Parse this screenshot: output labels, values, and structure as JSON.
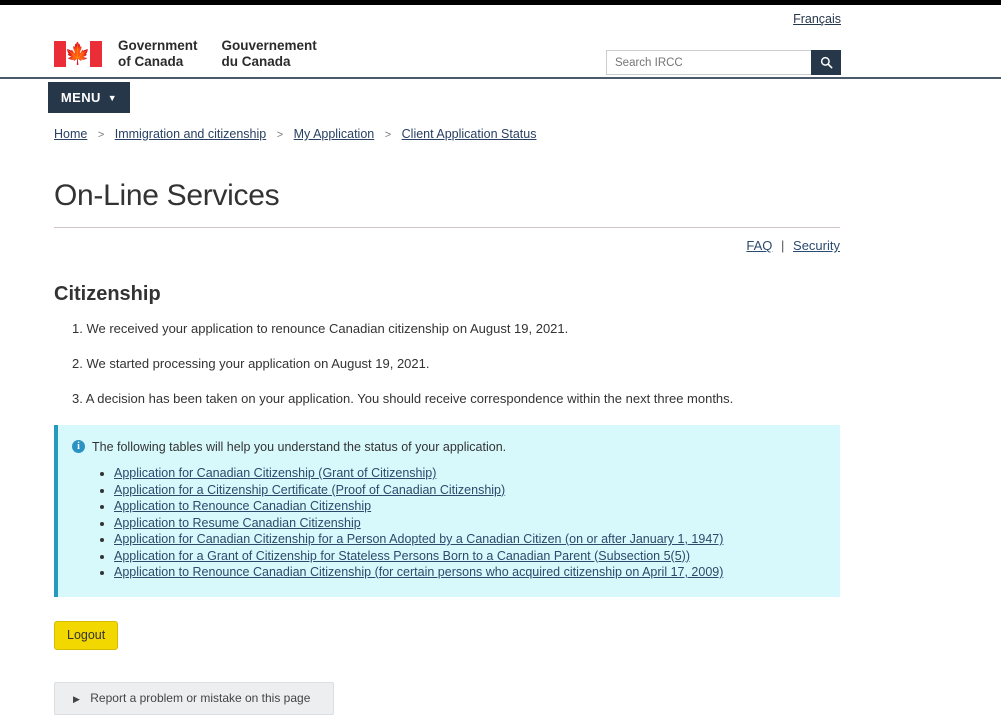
{
  "topbar": {
    "language_link": "Français"
  },
  "brand": {
    "flag_icon": "canada-flag-icon",
    "line_en_1": "Government",
    "line_en_2": "of Canada",
    "line_fr_1": "Gouvernement",
    "line_fr_2": "du Canada"
  },
  "search": {
    "placeholder": "Search IRCC",
    "value": "",
    "button_icon": "search-icon"
  },
  "menu": {
    "label": "MENU",
    "caret_icon": "chevron-down-icon"
  },
  "breadcrumb": {
    "separator": ">",
    "items": [
      {
        "label": "Home"
      },
      {
        "label": "Immigration and citizenship"
      },
      {
        "label": "My Application"
      },
      {
        "label": "Client Application Status"
      }
    ]
  },
  "main": {
    "page_title": "On-Line Services",
    "util_links": {
      "faq": "FAQ",
      "divider": "|",
      "security": "Security"
    },
    "section_title": "Citizenship",
    "status_items": [
      "1. We received your application to renounce Canadian citizenship on August 19, 2021.",
      "2. We started processing your application on August 19, 2021.",
      "3. A decision has been taken on your application. You should receive correspondence within the next three months."
    ],
    "alert": {
      "icon": "info-circle-icon",
      "icon_glyph": "i",
      "message": "The following tables will help you understand the status of your application.",
      "links": [
        "Application for Canadian Citizenship (Grant of Citizenship)",
        "Application for a Citizenship Certificate (Proof of Canadian Citizenship)",
        "Application to Renounce Canadian Citizenship",
        "Application to Resume Canadian Citizenship",
        "Application for Canadian Citizenship for a Person Adopted by a Canadian Citizen (on or after January 1, 1947)",
        "Application for a Grant of Citizenship for Stateless Persons Born to a Canadian Parent (Subsection 5(5))",
        "Application to Renounce Canadian Citizenship (for certain persons who acquired citizenship on April 17, 2009)"
      ]
    },
    "logout_label": "Logout",
    "report_problem": {
      "toggle_icon": "triangle-right-icon",
      "label": "Report a problem or mistake on this page"
    }
  },
  "colors": {
    "brand_navy": "#26374a",
    "flag_red": "#ea2d37",
    "alert_bg": "#d7f9fc",
    "alert_border": "#269abc",
    "logout_yellow": "#f3d800",
    "link_blue": "#2c4a6b"
  }
}
